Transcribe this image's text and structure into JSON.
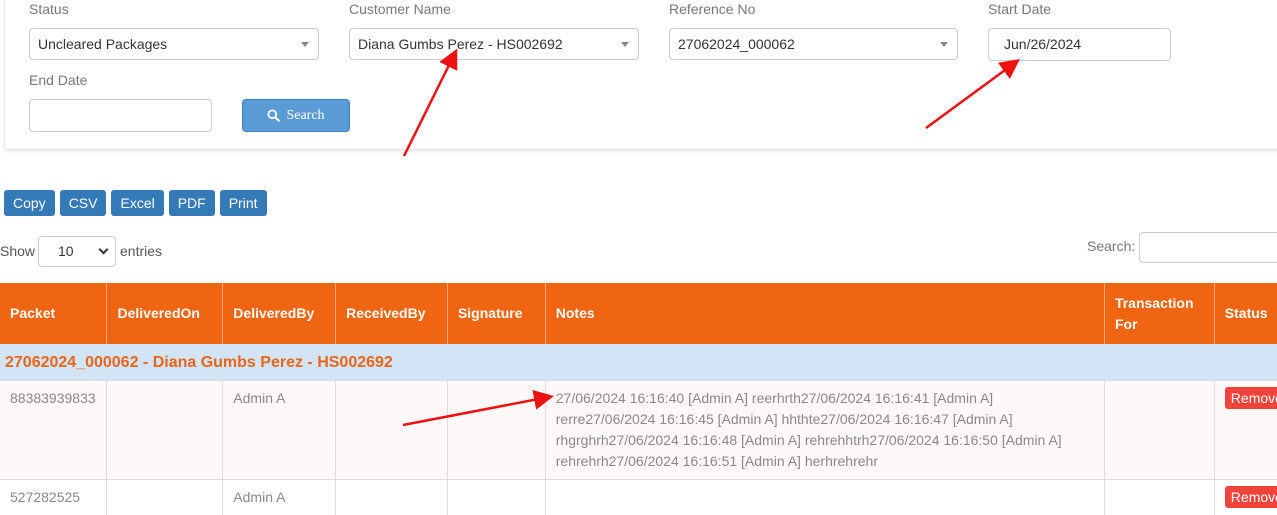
{
  "filters": {
    "status": {
      "label": "Status",
      "value": "Uncleared Packages"
    },
    "customer": {
      "label": "Customer Name",
      "value": "Diana Gumbs Perez - HS002692"
    },
    "reference": {
      "label": "Reference No",
      "value": "27062024_000062"
    },
    "start_date": {
      "label": "Start Date",
      "value": "Jun/26/2024"
    },
    "end_date": {
      "label": "End Date",
      "value": ""
    },
    "search_button": {
      "label": "Search",
      "icon": "search-icon"
    }
  },
  "export_buttons": [
    "Copy",
    "CSV",
    "Excel",
    "PDF",
    "Print"
  ],
  "length_menu": {
    "show_label": "Show",
    "value": "10",
    "entries_label": "entries"
  },
  "table_search": {
    "label": "Search:",
    "value": ""
  },
  "table": {
    "columns": [
      "Packet",
      "DeliveredOn",
      "DeliveredBy",
      "ReceivedBy",
      "Signature",
      "Notes",
      "Transaction For",
      "Status"
    ],
    "group_header": "27062024_000062 - Diana Gumbs Perez - HS002692",
    "rows": [
      {
        "packet": "88383939833",
        "delivered_on": "",
        "delivered_by": "Admin A",
        "received_by": "",
        "signature": "",
        "notes": "27/06/2024 16:16:40 [Admin A] reerhrth27/06/2024 16:16:41 [Admin A] rerre27/06/2024 16:16:45 [Admin A] hhthte27/06/2024 16:16:47 [Admin A] rhgrghrh27/06/2024 16:16:48 [Admin A] rehrehhtrh27/06/2024 16:16:50 [Admin A] rehrehrh27/06/2024 16:16:51 [Admin A] herhrehrehr",
        "transaction_for": "",
        "status_button": "Remove"
      },
      {
        "packet": "527282525",
        "delivered_on": "",
        "delivered_by": "Admin A",
        "received_by": "",
        "signature": "",
        "notes": "",
        "transaction_for": "",
        "status_button": "Remove"
      }
    ]
  },
  "colors": {
    "header_orange": "#ef6511",
    "group_bg": "#d2e4f5",
    "group_text": "#e8651a",
    "primary_blue": "#337ab7",
    "search_blue": "#5b9bd5",
    "remove_red": "#f0443b",
    "annotation_red": "#ee1111"
  }
}
